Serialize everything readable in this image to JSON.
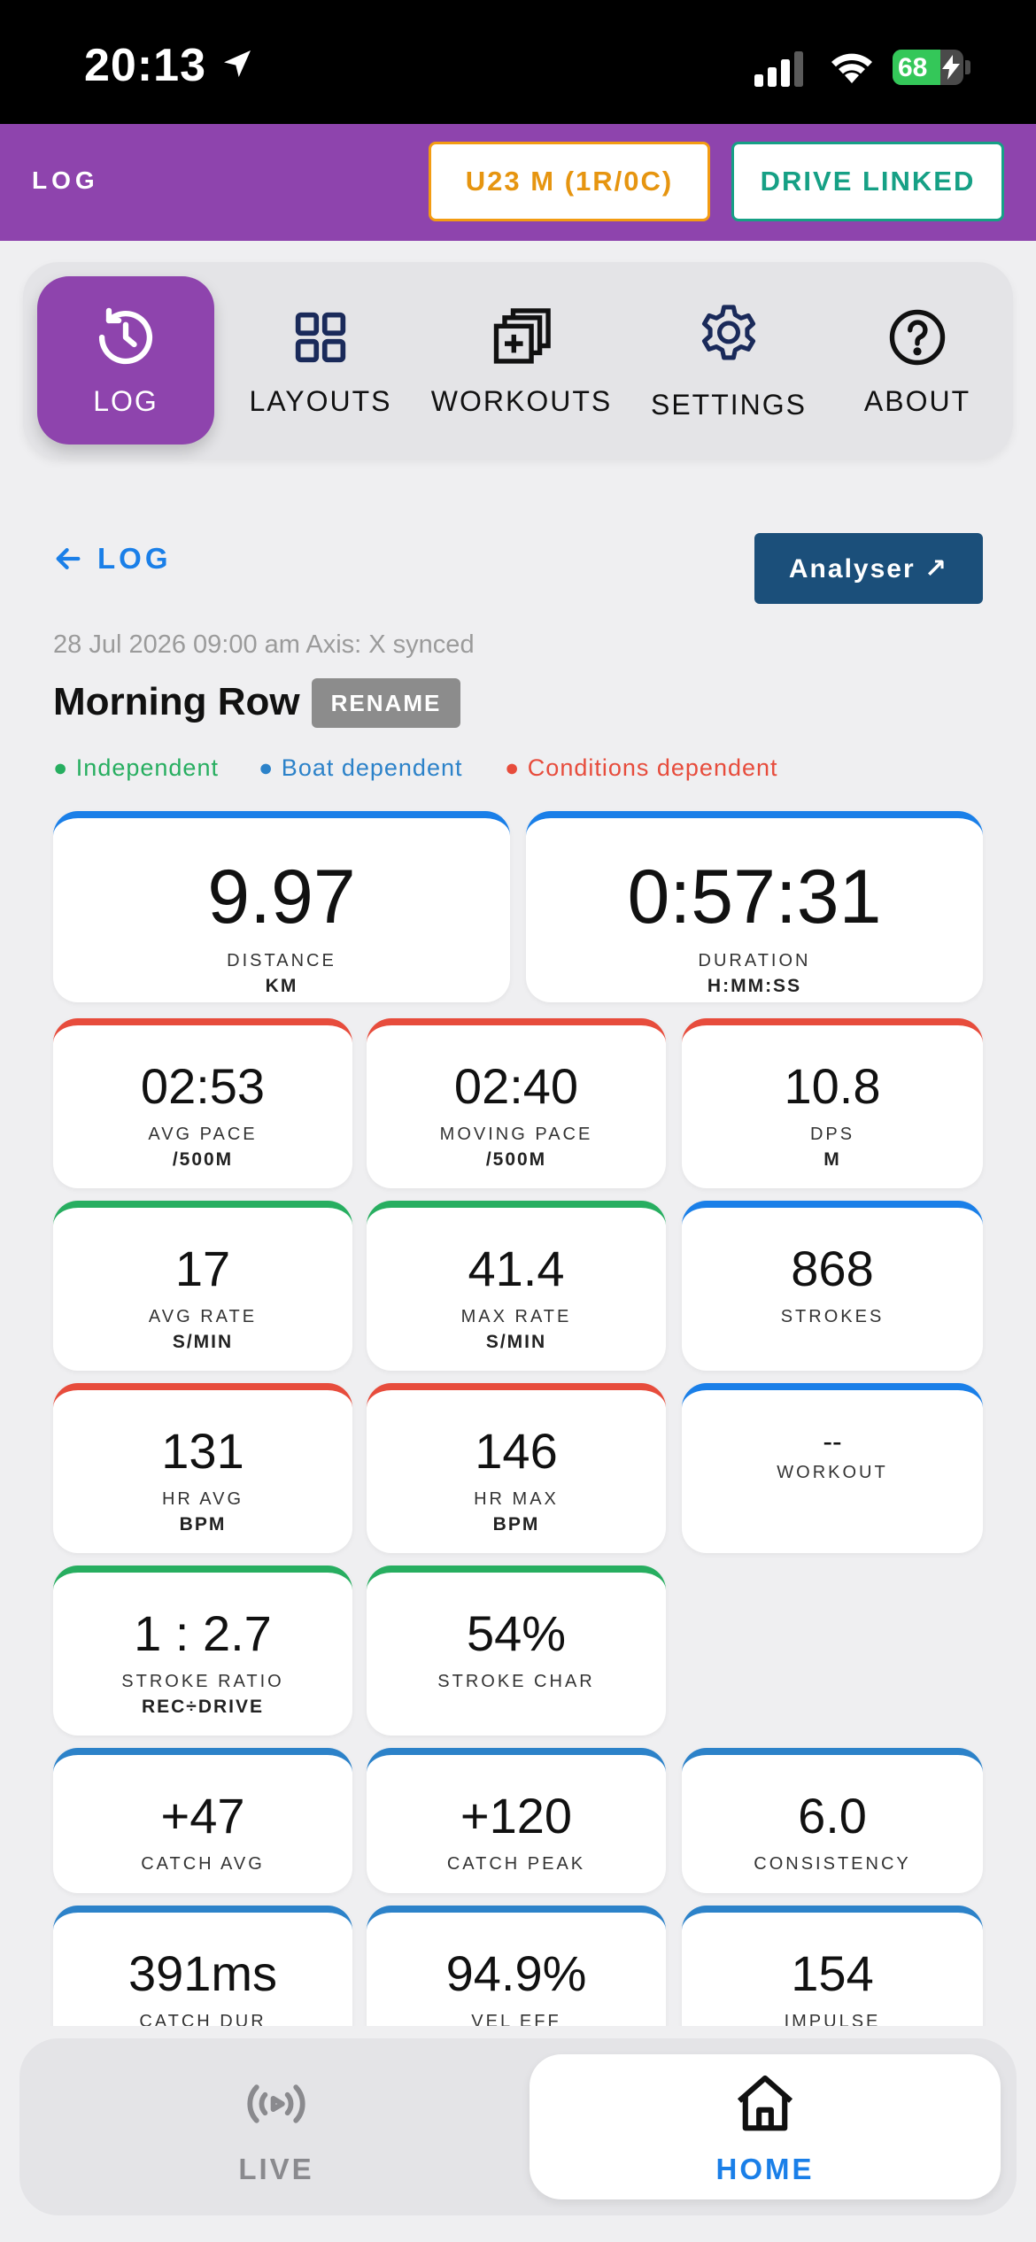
{
  "status_bar": {
    "time": "20:13",
    "battery": "68",
    "battery_level": 0.68
  },
  "header": {
    "title": "LOG",
    "boat_class": "U23 M (1R/0C)",
    "drive_status": "DRIVE LINKED"
  },
  "nav": {
    "tabs": [
      {
        "label": "LOG",
        "icon": "history-icon",
        "active": true
      },
      {
        "label": "LAYOUTS",
        "icon": "grid-icon",
        "active": false
      },
      {
        "label": "WORKOUTS",
        "icon": "stack-plus-icon",
        "active": false
      },
      {
        "label": "SETTINGS",
        "icon": "gear-icon",
        "active": false
      },
      {
        "label": "ABOUT",
        "icon": "question-icon",
        "active": false
      }
    ]
  },
  "content": {
    "back_label": "LOG",
    "analyser_label": "Analyser ↗",
    "meta": "28 Jul 2026 09:00 am Axis: X synced",
    "title": "Morning Row",
    "rename_label": "RENAME",
    "legend": [
      {
        "label": "● Independent",
        "color": "#27ae60"
      },
      {
        "label": "● Boat dependent",
        "color": "#2c82c9"
      },
      {
        "label": "● Conditions dependent",
        "color": "#e74c3c"
      }
    ]
  },
  "metrics": [
    {
      "value": "9.97",
      "label": "DISTANCE",
      "unit": "KM",
      "kind": "blue"
    },
    {
      "value": "0:57:31",
      "label": "DURATION",
      "unit": "H:MM:SS",
      "kind": "blue"
    },
    {
      "value": "02:53",
      "label": "AVG PACE",
      "unit": "/500M",
      "kind": "cond"
    },
    {
      "value": "02:40",
      "label": "MOVING PACE",
      "unit": "/500M",
      "kind": "cond"
    },
    {
      "value": "10.8",
      "label": "DPS",
      "unit": "M",
      "kind": "cond"
    },
    {
      "value": "17",
      "label": "AVG RATE",
      "unit": "S/MIN",
      "kind": "ind"
    },
    {
      "value": "41.4",
      "label": "MAX RATE",
      "unit": "S/MIN",
      "kind": "ind"
    },
    {
      "value": "868",
      "label": "STROKES",
      "unit": "",
      "kind": "blue"
    },
    {
      "value": "131",
      "label": "HR AVG",
      "unit": "BPM",
      "kind": "cond"
    },
    {
      "value": "146",
      "label": "HR MAX",
      "unit": "BPM",
      "kind": "cond"
    },
    {
      "value": "--",
      "label": "WORKOUT",
      "unit": "",
      "kind": "blue"
    },
    {
      "value": "1 : 2.7",
      "label": "STROKE RATIO",
      "unit": "REC÷DRIVE",
      "kind": "ind"
    },
    {
      "value": "54%",
      "label": "STROKE CHAR",
      "unit": "",
      "kind": "ind"
    },
    {
      "value": "+47",
      "label": "CATCH AVG",
      "unit": "",
      "kind": "boat"
    },
    {
      "value": "+120",
      "label": "CATCH PEAK",
      "unit": "",
      "kind": "boat"
    },
    {
      "value": "6.0",
      "label": "CONSISTENCY",
      "unit": "",
      "kind": "boat"
    },
    {
      "value": "391ms",
      "label": "CATCH DUR",
      "unit": "",
      "kind": "boat"
    },
    {
      "value": "94.9%",
      "label": "VEL EFF",
      "unit": "",
      "kind": "boat"
    },
    {
      "value": "154",
      "label": "IMPULSE",
      "unit": "",
      "kind": "boat"
    }
  ],
  "bottom_tabs": [
    {
      "label": "LIVE",
      "icon": "live-broadcast-icon",
      "active": false
    },
    {
      "label": "HOME",
      "icon": "home-icon",
      "active": true
    }
  ],
  "colors": {
    "accent_purple": "#8e44ad",
    "link_blue": "#1a7fe8",
    "analyser_navy": "#1b4f7a",
    "independent": "#27ae60",
    "boat": "#2c82c9",
    "conditions": "#e74c3c",
    "boat_class_orange": "#f39c12",
    "drive_teal": "#16a085"
  }
}
